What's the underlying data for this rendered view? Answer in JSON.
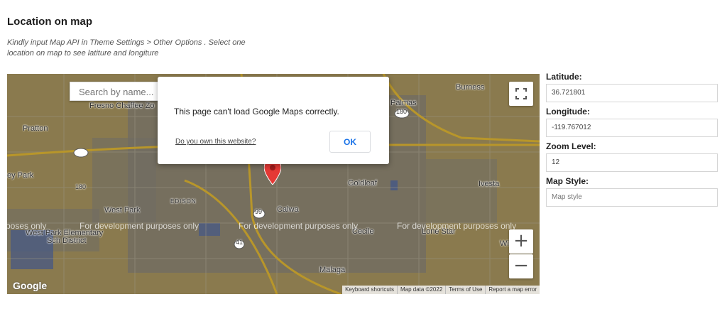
{
  "section": {
    "title": "Location on map",
    "description": "Kindly input Map API in Theme Settings > Other Options . Select one location on map to see latiture and longiture"
  },
  "map": {
    "search_placeholder": "Search by name...",
    "places": {
      "fresno_chaffee": "Fresno Chaffee Zo",
      "pratton": "Pratton",
      "palmas": "Palmas",
      "burness": "Burness",
      "goldleaf": "Goldleaf",
      "ivesta": "Ivesta",
      "key_park": "ey Park",
      "west_park": "West Park",
      "edison": "EDISON",
      "calwa": "Calwa",
      "cecile": "Cecile",
      "lone_star": "Lone Star",
      "school_line1": "West Park Elementary",
      "school_line2": "Sch District",
      "malaga": "Malaga",
      "wi": "Wi"
    },
    "highway_shields": {
      "h180_left": "180",
      "h180_right": "180",
      "h99": "99",
      "h41": "41"
    },
    "dev_watermarks": [
      "poses only",
      "For development purposes only",
      "For development purposes only",
      "For development purposes only"
    ],
    "zoom_in_label": "+",
    "zoom_out_label": "−",
    "google_logo": "Google",
    "footer_links": [
      "Keyboard shortcuts",
      "Map data ©2022",
      "Terms of Use",
      "Report a map error"
    ],
    "icons": {
      "fullscreen": "fullscreen-icon",
      "pin": "map-pin-icon"
    },
    "colors": {
      "land": "#8a7a4e",
      "dialog_ok": "#1a73e8",
      "pin": "#e53935"
    },
    "dialog": {
      "message": "This page can't load Google Maps correctly.",
      "link": "Do you own this website?",
      "ok_label": "OK"
    }
  },
  "fields": {
    "latitude_label": "Latitude:",
    "latitude_value": "36.721801",
    "longitude_label": "Longitude:",
    "longitude_value": "-119.767012",
    "zoom_label": "Zoom Level:",
    "zoom_value": "12",
    "style_label": "Map Style:",
    "style_placeholder": "Map style"
  }
}
